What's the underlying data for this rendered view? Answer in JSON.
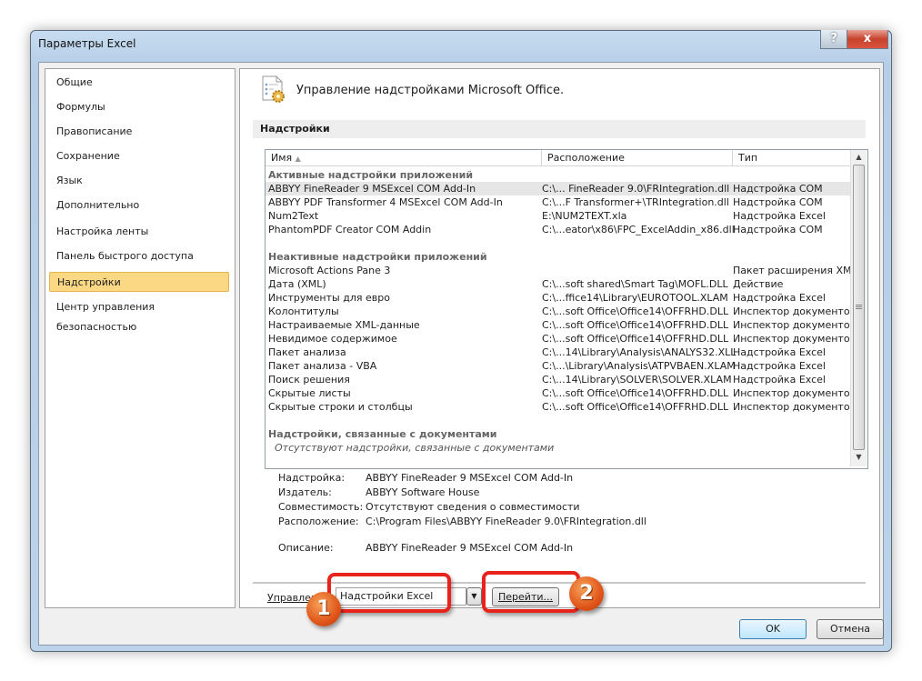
{
  "window": {
    "title": "Параметры Excel",
    "help": "?",
    "close": "x"
  },
  "sidebar": {
    "items": [
      {
        "label": "Общие"
      },
      {
        "label": "Формулы"
      },
      {
        "label": "Правописание"
      },
      {
        "label": "Сохранение"
      },
      {
        "label": "Язык"
      },
      {
        "label": "Дополнительно"
      },
      {
        "label": "Настройка ленты"
      },
      {
        "label": "Панель быстрого доступа"
      },
      {
        "label": "Надстройки",
        "selected": true
      },
      {
        "label": "Центр управления безопасностью"
      }
    ]
  },
  "main": {
    "heading": "Управление надстройками Microsoft Office.",
    "section": "Надстройки",
    "columns": [
      "Имя",
      "Расположение",
      "Тип"
    ],
    "groups": [
      {
        "title": "Активные надстройки приложений",
        "rows": [
          [
            "ABBYY FineReader 9 MSExcel COM Add-In",
            "C:\\... FineReader 9.0\\FRIntegration.dll",
            "Надстройка COM"
          ],
          [
            "ABBYY PDF Transformer 4 MSExcel COM Add-In",
            "C:\\...F Transformer+\\TRIntegration.dll",
            "Надстройка COM"
          ],
          [
            "Num2Text",
            "E:\\NUM2TEXT.xla",
            "Надстройка Excel"
          ],
          [
            "PhantomPDF Creator COM Addin",
            "C:\\...eator\\x86\\FPC_ExcelAddin_x86.dll",
            "Надстройка COM"
          ]
        ]
      },
      {
        "title": "Неактивные надстройки приложений",
        "rows": [
          [
            "Microsoft Actions Pane 3",
            "",
            "Пакет расширения XML"
          ],
          [
            "Дата (XML)",
            "C:\\...soft shared\\Smart Tag\\MOFL.DLL",
            "Действие"
          ],
          [
            "Инструменты для евро",
            "C:\\...ffice14\\Library\\EUROTOOL.XLAM",
            "Надстройка Excel"
          ],
          [
            "Колонтитулы",
            "C:\\...soft Office\\Office14\\OFFRHD.DLL",
            "Инспектор документов"
          ],
          [
            "Настраиваемые XML-данные",
            "C:\\...soft Office\\Office14\\OFFRHD.DLL",
            "Инспектор документов"
          ],
          [
            "Невидимое содержимое",
            "C:\\...soft Office\\Office14\\OFFRHD.DLL",
            "Инспектор документов"
          ],
          [
            "Пакет анализа",
            "C:\\...14\\Library\\Analysis\\ANALYS32.XLL",
            "Надстройка Excel"
          ],
          [
            "Пакет анализа - VBA",
            "C:\\...\\Library\\Analysis\\ATPVBAEN.XLAM",
            "Надстройка Excel"
          ],
          [
            "Поиск решения",
            "C:\\...14\\Library\\SOLVER\\SOLVER.XLAM",
            "Надстройка Excel"
          ],
          [
            "Скрытые листы",
            "C:\\...soft Office\\Office14\\OFFRHD.DLL",
            "Инспектор документов"
          ],
          [
            "Скрытые строки и столбцы",
            "C:\\...soft Office\\Office14\\OFFRHD.DLL",
            "Инспектор документов"
          ]
        ]
      },
      {
        "title": "Надстройки, связанные с документами",
        "empty": "Отсутствуют надстройки, связанные с документами",
        "rows": []
      }
    ],
    "details": [
      [
        "Надстройка:",
        "ABBYY FineReader 9 MSExcel COM Add-In"
      ],
      [
        "Издатель:",
        "ABBYY Software House"
      ],
      [
        "Совместимость:",
        "Отсутствуют сведения о совместимости"
      ],
      [
        "Расположение:",
        "C:\\Program Files\\ABBYY FineReader 9.0\\FRIntegration.dll"
      ],
      [
        "Описание:",
        "ABBYY FineReader 9 MSExcel COM Add-In"
      ]
    ],
    "manage_label": "Управление:",
    "manage_value": "Надстройки Excel",
    "go": "Перейти..."
  },
  "callouts": [
    "1",
    "2"
  ],
  "footer": {
    "ok": "OK",
    "cancel": "Отмена"
  },
  "colors": {
    "highlight": "#e8231b",
    "selected_nav": "#fbd883",
    "callout": "#e0561a"
  }
}
